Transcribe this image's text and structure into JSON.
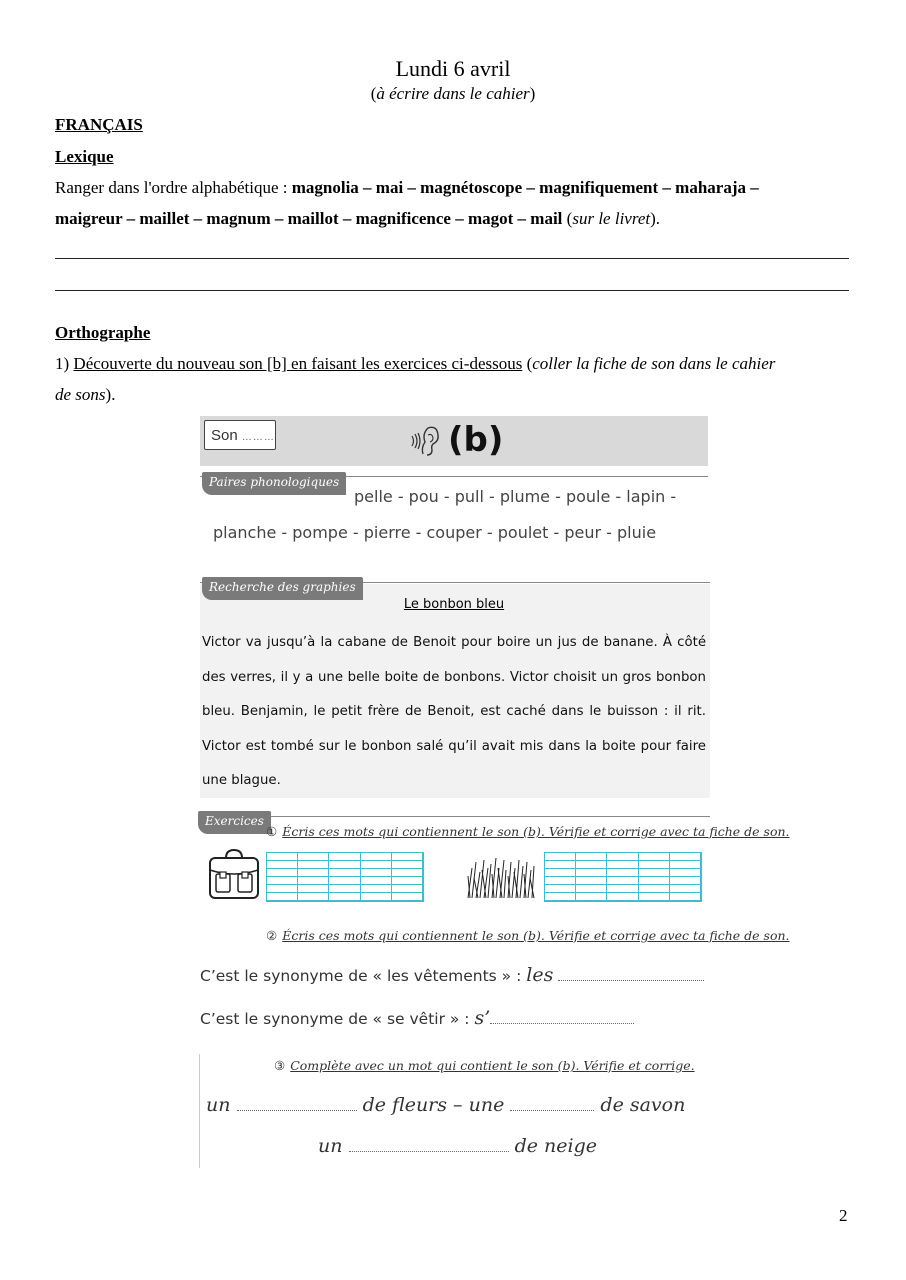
{
  "header": {
    "title": "Lundi 6 avril",
    "subtitle_open": "(",
    "subtitle_italic": "à écrire dans le cahier",
    "subtitle_close": ")"
  },
  "section": "FRANÇAIS",
  "lexique": {
    "heading": "Lexique",
    "instruction": "Ranger dans l'ordre alphabétique : ",
    "words_line1": "magnolia – mai – magnétoscope – magnifiquement – maharaja –",
    "words_line2": "maigreur – maillet – magnum – maillot – magnificence – magot – mail",
    "note_open": " (",
    "note_italic": "sur le livret",
    "note_close": ")."
  },
  "orthographe": {
    "heading": "Orthographe",
    "item_number": "1) ",
    "item_underlined": "Découverte du nouveau son [b] en faisant les exercices ci-dessous",
    "item_open": " (",
    "item_italic_1": "coller la fiche de son dans le cahier",
    "item_italic_2": "de sons",
    "item_close": ")."
  },
  "worksheet": {
    "son_label": "Son",
    "son_dots": "………",
    "sound_symbol": "(b)",
    "tags": {
      "paires": "Paires phonologiques",
      "recherche": "Recherche des graphies",
      "exercices": "Exercices"
    },
    "pairs_line1": "pelle - pou - pull - plume - poule - lapin -",
    "pairs_line2": "planche - pompe - pierre - couper - poulet - peur - pluie",
    "story_title": "Le bonbon bleu",
    "story_text": "Victor va jusqu’à la cabane de Benoit pour boire un jus de banane. À côté des verres, il y a une belle boite de bonbons. Victor choisit un gros bonbon bleu. Benjamin, le petit frère de Benoit, est caché dans le buisson : il rit. Victor est tombé sur le bonbon salé qu’il avait mis dans la boite pour faire une blague.",
    "exercise1": {
      "number": "①",
      "instruction": "Écris ces mots qui contiennent le son (b). Vérifie et corrige avec ta fiche de son."
    },
    "exercise2": {
      "number": "②",
      "instruction": "Écris ces mots qui contiennent le son (b). Vérifie et corrige avec ta fiche de son.",
      "line1_text": "C’est le synonyme de « les vêtements » :",
      "line1_start": "les",
      "line2_text": "C’est le synonyme de « se vêtir » :",
      "line2_start": "s’"
    },
    "exercise3": {
      "number": "③",
      "instruction": "Complète avec un mot qui contient le son (b). Vérifie et corrige.",
      "row1": [
        "un",
        "de fleurs – une",
        "de savon"
      ],
      "row2": [
        "un",
        "de neige"
      ]
    }
  },
  "page_number": "2"
}
